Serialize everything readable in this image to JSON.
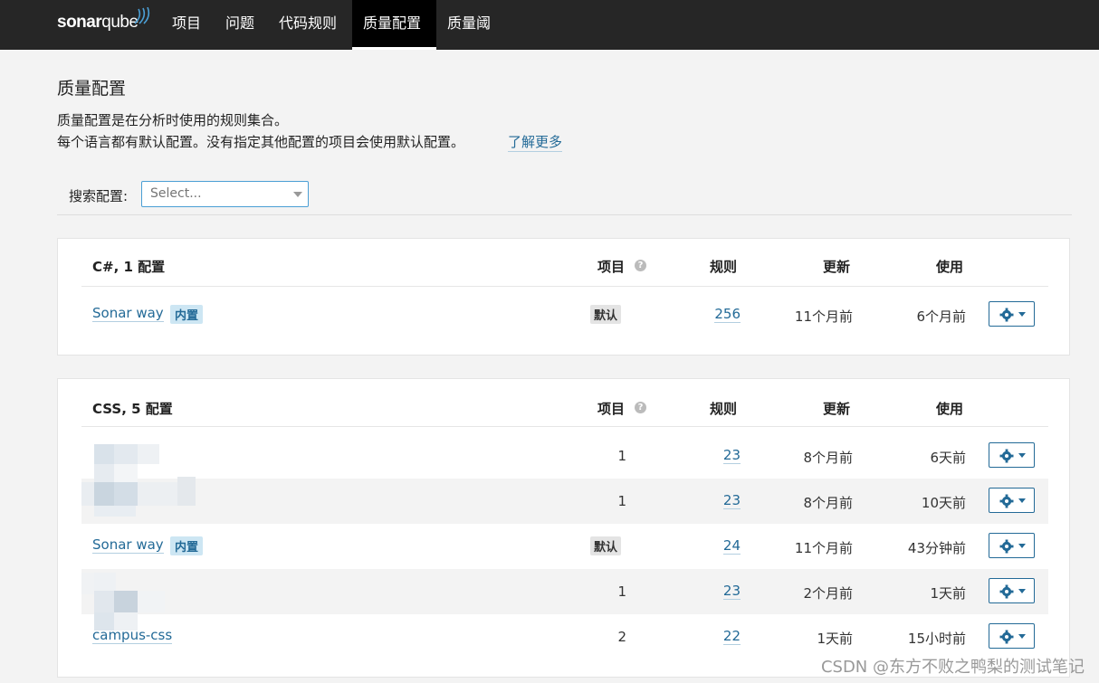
{
  "nav": {
    "logo_bold": "sonar",
    "logo_thin": "qube",
    "items": [
      "项目",
      "问题",
      "代码规则",
      "质量配置",
      "质量阈"
    ],
    "active": "质量配置"
  },
  "page": {
    "title": "质量配置",
    "desc1": "质量配置是在分析时使用的规则集合。",
    "desc2": "每个语言都有默认配置。没有指定其他配置的项目会使用默认配置。",
    "learn_more": "了解更多"
  },
  "search": {
    "label": "搜索配置:",
    "placeholder": "Select..."
  },
  "columns": {
    "projects": "项目",
    "rules": "规则",
    "updated": "更新",
    "used": "使用",
    "help": "?"
  },
  "groups": [
    {
      "title": "C#, 1 配置",
      "rows": [
        {
          "name": "Sonar way",
          "builtin": "内置",
          "default": "默认",
          "projects": "",
          "rules": "256",
          "updated": "11个月前",
          "used": "6个月前"
        }
      ]
    },
    {
      "title": "CSS, 5 配置",
      "rows": [
        {
          "name": "",
          "builtin": "",
          "default": "",
          "projects": "1",
          "rules": "23",
          "updated": "8个月前",
          "used": "6天前"
        },
        {
          "name": "",
          "builtin": "",
          "default": "",
          "projects": "1",
          "rules": "23",
          "updated": "8个月前",
          "used": "10天前"
        },
        {
          "name": "Sonar way",
          "builtin": "内置",
          "default": "默认",
          "projects": "",
          "rules": "24",
          "updated": "11个月前",
          "used": "43分钟前"
        },
        {
          "name": "",
          "builtin": "",
          "default": "",
          "projects": "1",
          "rules": "23",
          "updated": "2个月前",
          "used": "1天前"
        },
        {
          "name": "campus-css",
          "builtin": "",
          "default": "",
          "projects": "2",
          "rules": "22",
          "updated": "1天前",
          "used": "15小时前"
        }
      ]
    }
  ],
  "watermark": "CSDN @东方不败之鸭梨的测试笔记"
}
